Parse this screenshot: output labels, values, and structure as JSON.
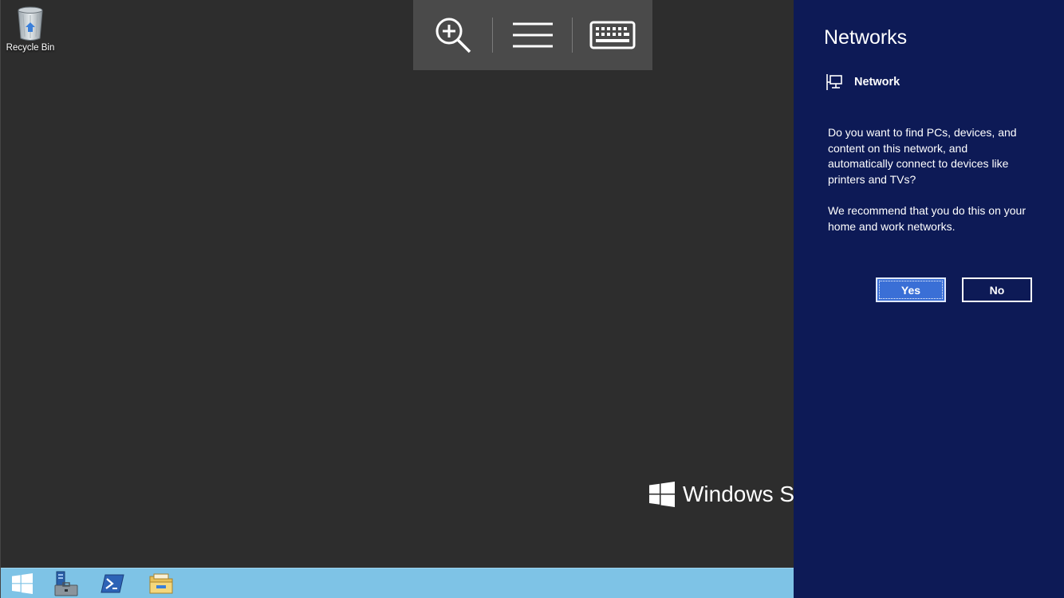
{
  "desktop": {
    "recycle_bin_label": "Recycle Bin",
    "branding_text": "Windows Se",
    "background_color": "#2d2d2d"
  },
  "remote_toolbar": {
    "items": [
      "zoom-in-icon",
      "menu-icon",
      "keyboard-icon"
    ]
  },
  "taskbar": {
    "color": "#7ec3e6",
    "items": [
      "windows-start-icon",
      "server-manager-icon",
      "powershell-icon",
      "file-explorer-icon"
    ]
  },
  "networks_panel": {
    "title": "Networks",
    "network_name": "Network",
    "question": "Do you want to find PCs, devices, and content on this network, and automatically connect to devices like printers and TVs?",
    "recommendation": "We recommend that you do this on your home and work networks.",
    "yes_label": "Yes",
    "no_label": "No",
    "background_color": "#0d1a56"
  }
}
